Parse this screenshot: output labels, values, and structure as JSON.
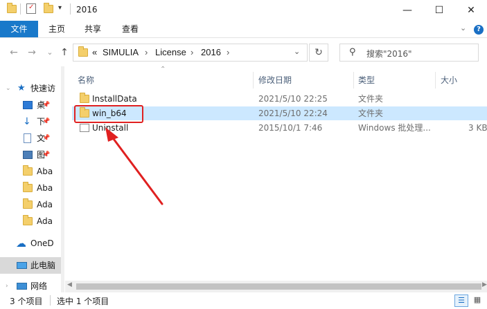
{
  "window": {
    "title": "2016",
    "minimize": "—",
    "maximize": "☐",
    "close": "✕"
  },
  "ribbon": {
    "tabs": [
      "文件",
      "主页",
      "共享",
      "查看"
    ],
    "help": "?",
    "collapse": "⌄"
  },
  "nav_buttons": {
    "back": "←",
    "forward": "→",
    "recent": "⌄",
    "up": "↑"
  },
  "address": {
    "overflow": "«",
    "crumbs": [
      "SIMULIA",
      "License",
      "2016"
    ],
    "sep": "›",
    "dropdown": "⌄",
    "refresh": "↻"
  },
  "search": {
    "placeholder": "搜索\"2016\"",
    "icon": "⚲"
  },
  "navpane": {
    "items": [
      {
        "label": "快速访",
        "icon": "star-icon"
      },
      {
        "label": "桌",
        "icon": "desktop-icon"
      },
      {
        "label": "下",
        "icon": "download-icon"
      },
      {
        "label": "文",
        "icon": "document-icon"
      },
      {
        "label": "图",
        "icon": "picture-icon"
      },
      {
        "label": "Aba",
        "icon": "folder-icon"
      },
      {
        "label": "Aba",
        "icon": "folder-icon"
      },
      {
        "label": "Ada",
        "icon": "folder-icon"
      },
      {
        "label": "Ada",
        "icon": "folder-icon"
      },
      {
        "label": "OneD",
        "icon": "cloud-icon"
      },
      {
        "label": "此电脑",
        "icon": "computer-icon"
      },
      {
        "label": "网络",
        "icon": "network-icon"
      }
    ]
  },
  "columns": {
    "name": "名称",
    "date": "修改日期",
    "type": "类型",
    "size": "大小"
  },
  "files": [
    {
      "name": "InstallData",
      "date": "2021/5/10 22:25",
      "type": "文件夹",
      "size": "",
      "icon": "folder-icon"
    },
    {
      "name": "win_b64",
      "date": "2021/5/10 22:24",
      "type": "文件夹",
      "size": "",
      "icon": "folder-icon",
      "selected": true
    },
    {
      "name": "Uninstall",
      "date": "2015/10/1 7:46",
      "type": "Windows 批处理...",
      "size": "3 KB",
      "icon": "batch-file-icon"
    }
  ],
  "status": {
    "count": "3 个项目",
    "selected": "选中 1 个项目"
  },
  "colors": {
    "accent": "#1979ca",
    "selection": "#cce8ff",
    "annotation": "#e02020"
  }
}
